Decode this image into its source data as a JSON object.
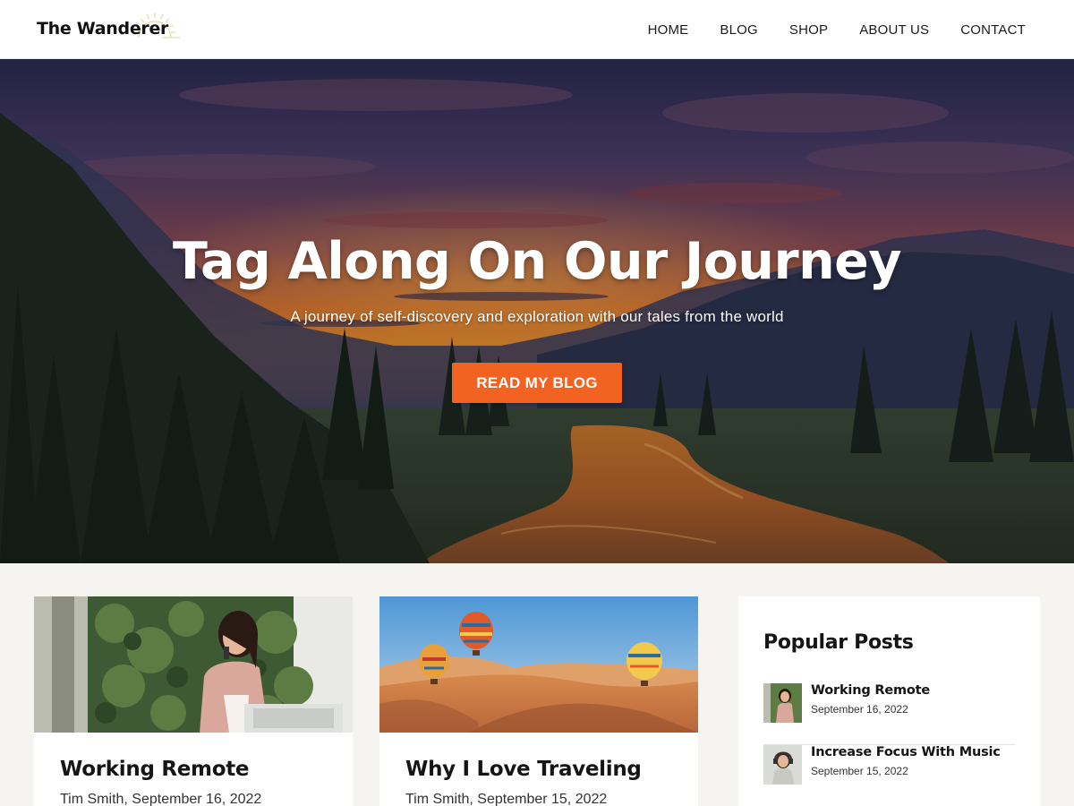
{
  "site": {
    "logo_text": "The Wanderer"
  },
  "nav": {
    "items": [
      {
        "label": "HOME"
      },
      {
        "label": "BLOG"
      },
      {
        "label": "SHOP"
      },
      {
        "label": "ABOUT US"
      },
      {
        "label": "CONTACT"
      }
    ]
  },
  "hero": {
    "title": "Tag Along On Our Journey",
    "subtitle": "A journey of self-discovery and exploration with our tales from the world",
    "button_label": "READ MY BLOG"
  },
  "posts": [
    {
      "title": "Working Remote",
      "meta": "Tim Smith, September 16, 2022",
      "image": "woman-on-phone-photo"
    },
    {
      "title": "Why I Love Traveling",
      "meta": "Tim Smith, September 15, 2022",
      "image": "hot-air-balloons-desert-photo"
    }
  ],
  "sidebar": {
    "title": "Popular Posts",
    "items": [
      {
        "title": "Working Remote",
        "date": "September 16, 2022"
      },
      {
        "title": "Increase Focus With Music",
        "date": "September 15, 2022"
      }
    ]
  },
  "colors": {
    "accent": "#f26322",
    "page_bg": "#f5f4f1",
    "header_bg": "#ffffff"
  }
}
